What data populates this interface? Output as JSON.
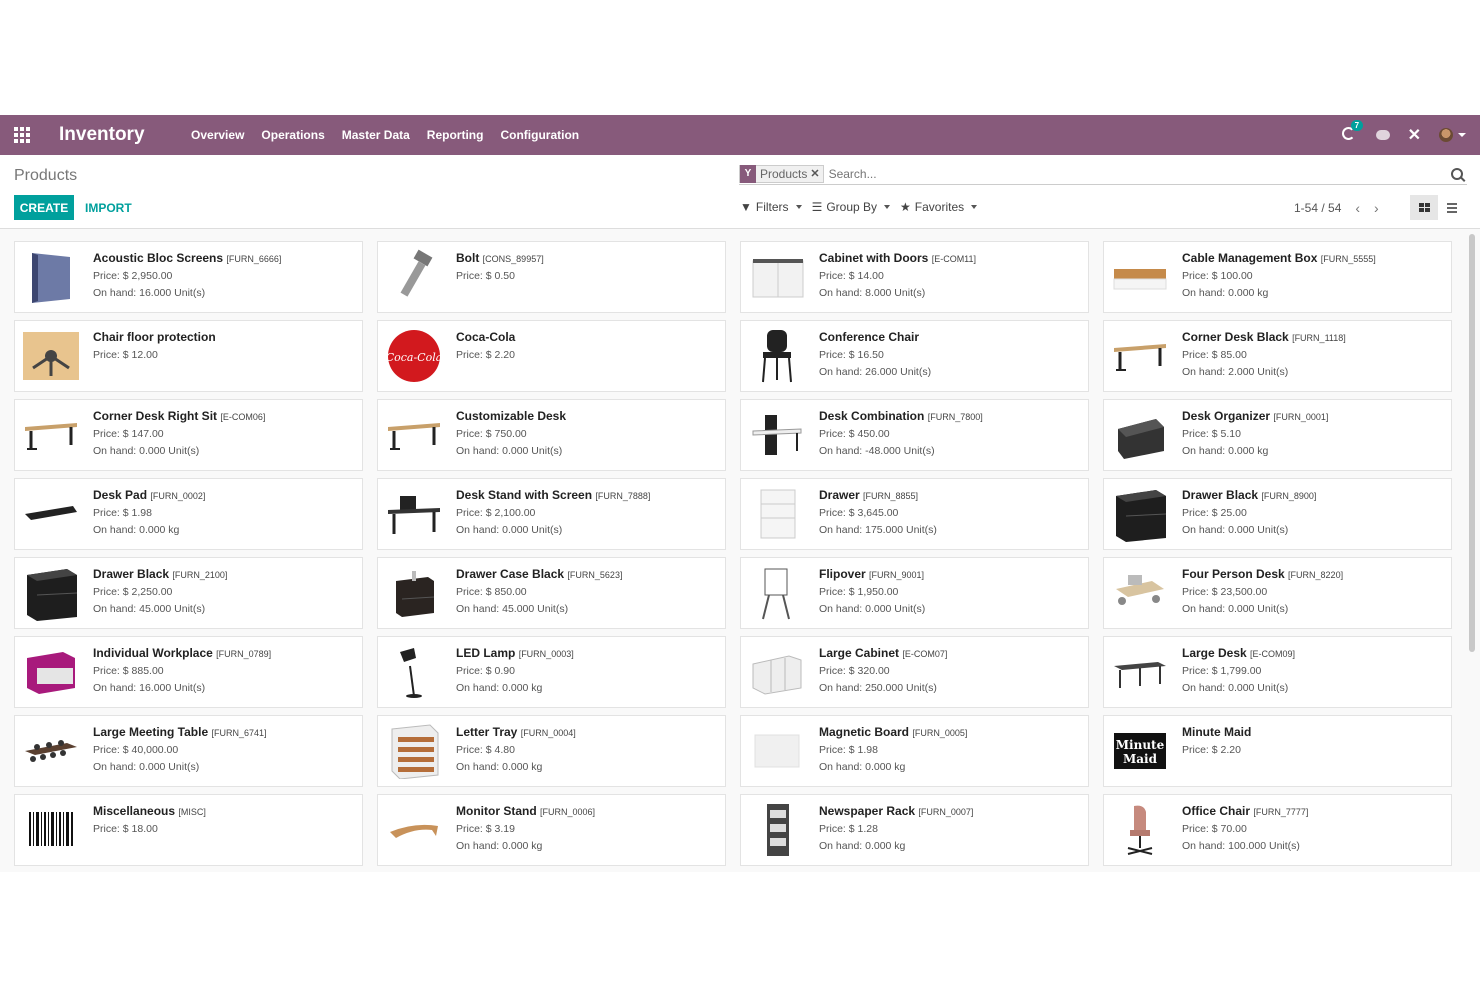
{
  "navbar": {
    "app_name": "Inventory",
    "menu": [
      "Overview",
      "Operations",
      "Master Data",
      "Reporting",
      "Configuration"
    ],
    "activity_count": "7",
    "color": "#875a7b"
  },
  "control_panel": {
    "title": "Products",
    "create_label": "CREATE",
    "import_label": "IMPORT",
    "facet_label": "Products",
    "search_placeholder": "Search...",
    "filters_label": "Filters",
    "group_by_label": "Group By",
    "favorites_label": "Favorites",
    "pager": "1-54 / 54",
    "accent": "#00a09d"
  },
  "products": [
    {
      "name": "Acoustic Bloc Screens",
      "ref": "[FURN_6666]",
      "price": "Price: $ 2,950.00",
      "onhand": "On hand: 16.000 Unit(s)",
      "icon": "screen-panel-icon"
    },
    {
      "name": "Bolt",
      "ref": "[CONS_89957]",
      "price": "Price: $ 0.50",
      "onhand": "",
      "icon": "bolt-icon"
    },
    {
      "name": "Cabinet with Doors",
      "ref": "[E-COM11]",
      "price": "Price: $ 14.00",
      "onhand": "On hand: 8.000 Unit(s)",
      "icon": "cabinet-icon"
    },
    {
      "name": "Cable Management Box",
      "ref": "[FURN_5555]",
      "price": "Price: $ 100.00",
      "onhand": "On hand: 0.000 kg",
      "icon": "cable-box-icon"
    },
    {
      "name": "Chair floor protection",
      "ref": "",
      "price": "Price: $ 12.00",
      "onhand": "",
      "icon": "floor-protection-icon"
    },
    {
      "name": "Coca-Cola",
      "ref": "",
      "price": "Price: $ 2.20",
      "onhand": "",
      "icon": "coca-cola-icon"
    },
    {
      "name": "Conference Chair",
      "ref": "",
      "price": "Price: $ 16.50",
      "onhand": "On hand: 26.000 Unit(s)",
      "icon": "chair-icon"
    },
    {
      "name": "Corner Desk Black",
      "ref": "[FURN_1118]",
      "price": "Price: $ 85.00",
      "onhand": "On hand: 2.000 Unit(s)",
      "icon": "desk-icon"
    },
    {
      "name": "Corner Desk Right Sit",
      "ref": "[E-COM06]",
      "price": "Price: $ 147.00",
      "onhand": "On hand: 0.000 Unit(s)",
      "icon": "desk-icon"
    },
    {
      "name": "Customizable Desk",
      "ref": "",
      "price": "Price: $ 750.00",
      "onhand": "On hand: 0.000 Unit(s)",
      "icon": "desk-icon"
    },
    {
      "name": "Desk Combination",
      "ref": "[FURN_7800]",
      "price": "Price: $ 450.00",
      "onhand": "On hand: -48.000 Unit(s)",
      "icon": "desk-combo-icon"
    },
    {
      "name": "Desk Organizer",
      "ref": "[FURN_0001]",
      "price": "Price: $ 5.10",
      "onhand": "On hand: 0.000 kg",
      "icon": "organizer-icon"
    },
    {
      "name": "Desk Pad",
      "ref": "[FURN_0002]",
      "price": "Price: $ 1.98",
      "onhand": "On hand: 0.000 kg",
      "icon": "desk-pad-icon"
    },
    {
      "name": "Desk Stand with Screen",
      "ref": "[FURN_7888]",
      "price": "Price: $ 2,100.00",
      "onhand": "On hand: 0.000 Unit(s)",
      "icon": "desk-stand-icon"
    },
    {
      "name": "Drawer",
      "ref": "[FURN_8855]",
      "price": "Price: $ 3,645.00",
      "onhand": "On hand: 175.000 Unit(s)",
      "icon": "drawer-white-icon"
    },
    {
      "name": "Drawer Black",
      "ref": "[FURN_8900]",
      "price": "Price: $ 25.00",
      "onhand": "On hand: 0.000 Unit(s)",
      "icon": "drawer-black-icon"
    },
    {
      "name": "Drawer Black",
      "ref": "[FURN_2100]",
      "price": "Price: $ 2,250.00",
      "onhand": "On hand: 45.000 Unit(s)",
      "icon": "drawer-black-icon"
    },
    {
      "name": "Drawer Case Black",
      "ref": "[FURN_5623]",
      "price": "Price: $ 850.00",
      "onhand": "On hand: 45.000 Unit(s)",
      "icon": "drawer-case-icon"
    },
    {
      "name": "Flipover",
      "ref": "[FURN_9001]",
      "price": "Price: $ 1,950.00",
      "onhand": "On hand: 0.000 Unit(s)",
      "icon": "flipover-icon"
    },
    {
      "name": "Four Person Desk",
      "ref": "[FURN_8220]",
      "price": "Price: $ 23,500.00",
      "onhand": "On hand: 0.000 Unit(s)",
      "icon": "four-desk-icon"
    },
    {
      "name": "Individual Workplace",
      "ref": "[FURN_0789]",
      "price": "Price: $ 885.00",
      "onhand": "On hand: 16.000 Unit(s)",
      "icon": "workplace-icon"
    },
    {
      "name": "LED Lamp",
      "ref": "[FURN_0003]",
      "price": "Price: $ 0.90",
      "onhand": "On hand: 0.000 kg",
      "icon": "lamp-icon"
    },
    {
      "name": "Large Cabinet",
      "ref": "[E-COM07]",
      "price": "Price: $ 320.00",
      "onhand": "On hand: 250.000 Unit(s)",
      "icon": "large-cabinet-icon"
    },
    {
      "name": "Large Desk",
      "ref": "[E-COM09]",
      "price": "Price: $ 1,799.00",
      "onhand": "On hand: 0.000 Unit(s)",
      "icon": "large-desk-icon"
    },
    {
      "name": "Large Meeting Table",
      "ref": "[FURN_6741]",
      "price": "Price: $ 40,000.00",
      "onhand": "On hand: 0.000 Unit(s)",
      "icon": "meeting-table-icon"
    },
    {
      "name": "Letter Tray",
      "ref": "[FURN_0004]",
      "price": "Price: $ 4.80",
      "onhand": "On hand: 0.000 kg",
      "icon": "letter-tray-icon"
    },
    {
      "name": "Magnetic Board",
      "ref": "[FURN_0005]",
      "price": "Price: $ 1.98",
      "onhand": "On hand: 0.000 kg",
      "icon": "board-icon"
    },
    {
      "name": "Minute Maid",
      "ref": "",
      "price": "Price: $ 2.20",
      "onhand": "",
      "icon": "minute-maid-icon",
      "logo_text": "Minute Maid"
    },
    {
      "name": "Miscellaneous",
      "ref": "[MISC]",
      "price": "Price: $ 18.00",
      "onhand": "",
      "icon": "barcode-icon"
    },
    {
      "name": "Monitor Stand",
      "ref": "[FURN_0006]",
      "price": "Price: $ 3.19",
      "onhand": "On hand: 0.000 kg",
      "icon": "monitor-stand-icon"
    },
    {
      "name": "Newspaper Rack",
      "ref": "[FURN_0007]",
      "price": "Price: $ 1.28",
      "onhand": "On hand: 0.000 kg",
      "icon": "rack-icon"
    },
    {
      "name": "Office Chair",
      "ref": "[FURN_7777]",
      "price": "Price: $ 70.00",
      "onhand": "On hand: 100.000 Unit(s)",
      "icon": "office-chair-icon"
    }
  ]
}
